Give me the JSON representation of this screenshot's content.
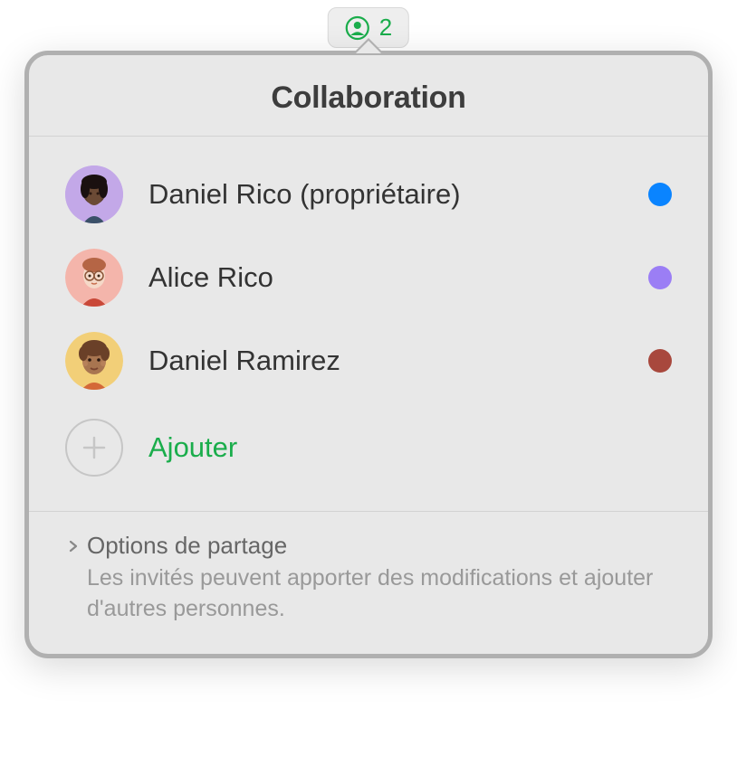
{
  "pill": {
    "count": "2"
  },
  "popover": {
    "title": "Collaboration",
    "participants": [
      {
        "name": "Daniel Rico (propriétaire)",
        "avatar_bg": "#c3a8e8",
        "dot_color": "#0a84ff"
      },
      {
        "name": "Alice Rico",
        "avatar_bg": "#f4b5ab",
        "dot_color": "#9b7ef5"
      },
      {
        "name": "Daniel Ramirez",
        "avatar_bg": "#f2cf78",
        "dot_color": "#a8483d"
      }
    ],
    "add_label": "Ajouter",
    "share_options": {
      "title": "Options de partage",
      "description": "Les invités peuvent apporter des modifications et ajouter d'autres personnes."
    },
    "accent_color": "#1aad4b"
  }
}
